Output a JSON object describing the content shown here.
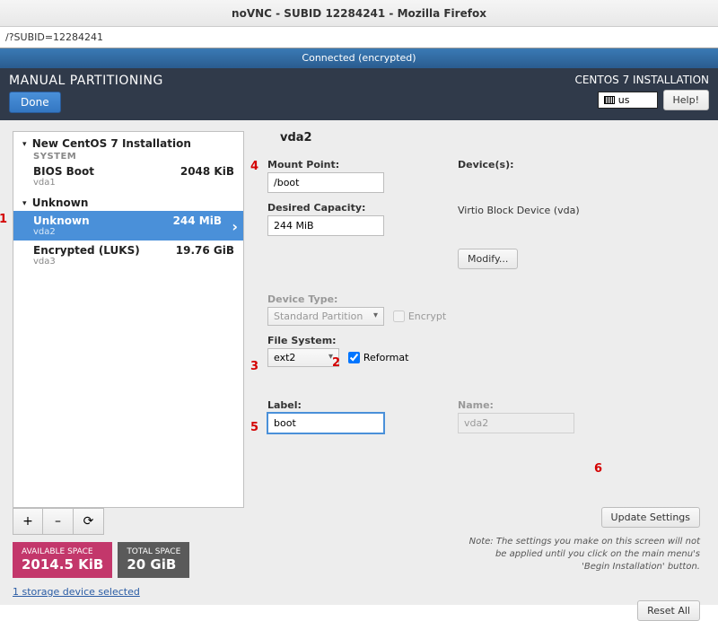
{
  "window": {
    "title": "noVNC - SUBID 12284241 - Mozilla Firefox"
  },
  "urlbar": {
    "text": "/?SUBID=12284241"
  },
  "vnc": {
    "status": "Connected (encrypted)"
  },
  "header": {
    "title": "MANUAL PARTITIONING",
    "done": "Done",
    "product": "CENTOS 7 INSTALLATION",
    "lang": "us",
    "help": "Help!"
  },
  "tree": {
    "section1": "New CentOS 7 Installation",
    "system_label": "SYSTEM",
    "p1": {
      "name": "BIOS Boot",
      "dev": "vda1",
      "size": "2048 KiB"
    },
    "section2": "Unknown",
    "p2": {
      "name": "Unknown",
      "dev": "vda2",
      "size": "244 MiB"
    },
    "p3": {
      "name": "Encrypted (LUKS)",
      "dev": "vda3",
      "size": "19.76 GiB"
    }
  },
  "toolbar": {
    "add": "+",
    "remove": "–",
    "reload": "⟳"
  },
  "space": {
    "avail_label": "AVAILABLE SPACE",
    "avail_value": "2014.5 KiB",
    "total_label": "TOTAL SPACE",
    "total_value": "20 GiB"
  },
  "storage_link": "1 storage device selected",
  "right": {
    "title": "vda2",
    "mount_label": "Mount Point:",
    "mount_value": "/boot",
    "capacity_label": "Desired Capacity:",
    "capacity_value": "244 MiB",
    "devices_label": "Device(s):",
    "device_text": "Virtio Block Device (vda)",
    "modify": "Modify...",
    "devtype_label": "Device Type:",
    "devtype_value": "Standard Partition",
    "encrypt_label": "Encrypt",
    "fs_label": "File System:",
    "fs_value": "ext2",
    "reformat_label": "Reformat",
    "label_label": "Label:",
    "label_value": "boot",
    "name_label": "Name:",
    "name_value": "vda2",
    "update": "Update Settings",
    "note": "Note:  The settings you make on this screen will not be applied until you click on the main menu's 'Begin Installation' button.",
    "reset": "Reset All"
  },
  "annotations": {
    "a1": "1",
    "a2": "2",
    "a3": "3",
    "a4": "4",
    "a5": "5",
    "a6": "6"
  }
}
